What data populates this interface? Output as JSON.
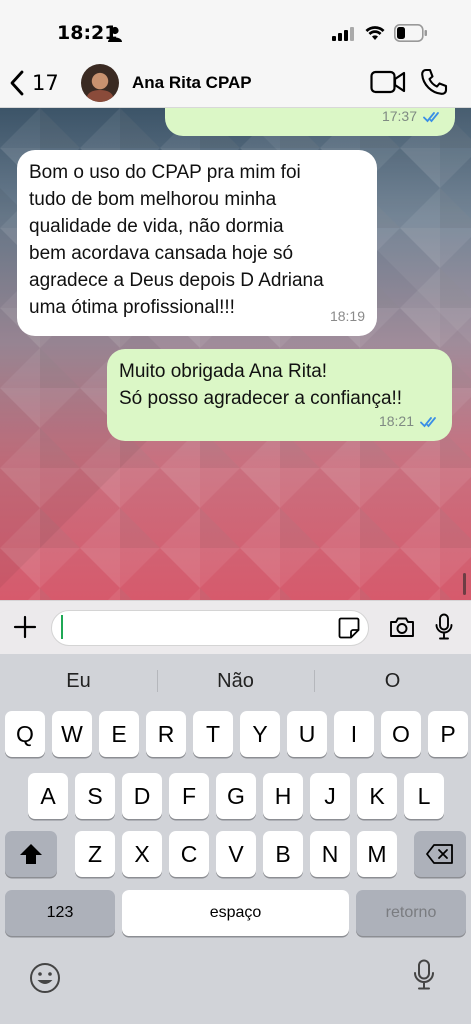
{
  "status_bar": {
    "time": "18:21"
  },
  "header": {
    "back_count": "17",
    "contact_name": "Ana Rita CPAP"
  },
  "messages": [
    {
      "direction": "out",
      "text": "",
      "time": "17:37",
      "read": true
    },
    {
      "direction": "in",
      "lines": [
        "Bom o uso do CPAP pra mim foi",
        "tudo de bom melhorou minha",
        "qualidade de vida, não dormia",
        "bem acordava cansada hoje só",
        "agradece a Deus depois D Adriana",
        "uma ótima profissional!!!"
      ],
      "time": "18:19"
    },
    {
      "direction": "out",
      "lines": [
        "Muito obrigada Ana Rita!",
        "Só posso agradecer a confiança!!"
      ],
      "time": "18:21",
      "read": true
    }
  ],
  "input": {
    "value": "",
    "placeholder": ""
  },
  "keyboard": {
    "suggestions": [
      "Eu",
      "Não",
      "O"
    ],
    "row1": [
      "Q",
      "W",
      "E",
      "R",
      "T",
      "Y",
      "U",
      "I",
      "O",
      "P"
    ],
    "row2": [
      "A",
      "S",
      "D",
      "F",
      "G",
      "H",
      "J",
      "K",
      "L"
    ],
    "row3": [
      "Z",
      "X",
      "C",
      "V",
      "B",
      "N",
      "M"
    ],
    "numbers_key": "123",
    "space_key": "espaço",
    "return_key": "retorno"
  },
  "colors": {
    "outgoing_bubble": "#dbf7c6",
    "incoming_bubble": "#ffffff",
    "read_ticks": "#3a8ee6",
    "accent_green": "#1fa855"
  }
}
